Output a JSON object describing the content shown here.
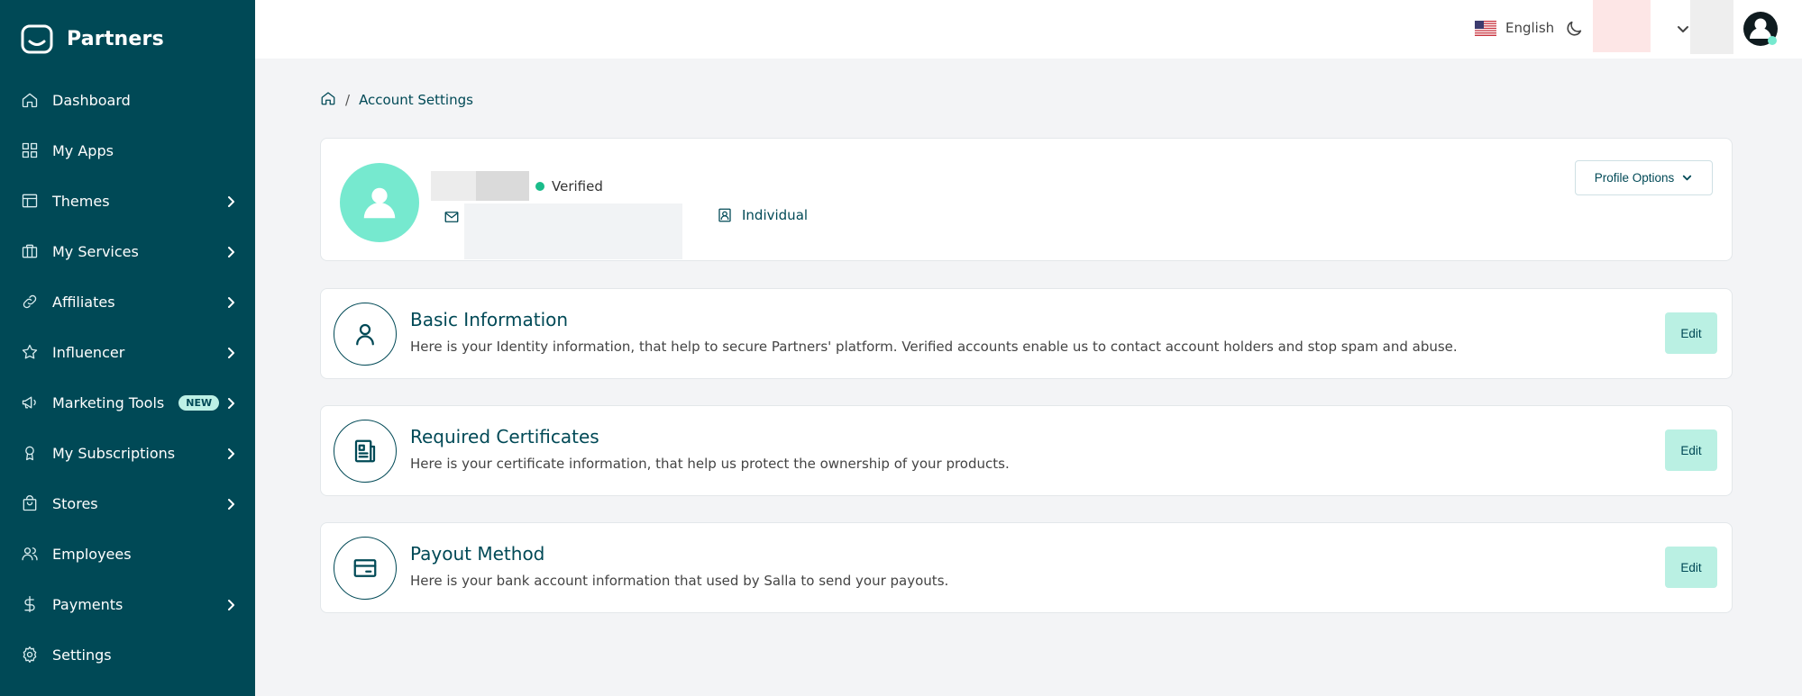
{
  "sidebar": {
    "brand": "Partners",
    "items": [
      {
        "label": "Dashboard",
        "icon": "home-icon",
        "has_chevron": false
      },
      {
        "label": "My Apps",
        "icon": "apps-grid-icon",
        "has_chevron": false
      },
      {
        "label": "Themes",
        "icon": "layout-icon",
        "has_chevron": true
      },
      {
        "label": "My Services",
        "icon": "briefcase-icon",
        "has_chevron": true
      },
      {
        "label": "Affiliates",
        "icon": "link-icon",
        "has_chevron": true
      },
      {
        "label": "Influencer",
        "icon": "star-icon",
        "has_chevron": true
      },
      {
        "label": "Marketing Tools",
        "icon": "megaphone-icon",
        "has_chevron": true,
        "badge": "NEW"
      },
      {
        "label": "My Subscriptions",
        "icon": "award-icon",
        "has_chevron": true
      },
      {
        "label": "Stores",
        "icon": "shopping-bag-icon",
        "has_chevron": true
      },
      {
        "label": "Employees",
        "icon": "users-icon",
        "has_chevron": false
      },
      {
        "label": "Payments",
        "icon": "dollar-icon",
        "has_chevron": true
      },
      {
        "label": "Settings",
        "icon": "gear-icon",
        "has_chevron": false
      }
    ]
  },
  "topbar": {
    "language": "English",
    "language_flag": "us-flag-icon",
    "theme_toggle": "moon-icon"
  },
  "breadcrumb": {
    "home_icon": "home-icon",
    "separator": "/",
    "current": "Account Settings"
  },
  "profile": {
    "status": "Verified",
    "account_type": "Individual",
    "options_label": "Profile Options"
  },
  "sections": [
    {
      "title": "Basic Information",
      "description": "Here is your Identity information, that help to secure Partners' platform. Verified accounts enable us to contact account holders and stop spam and abuse.",
      "icon": "user-icon",
      "action": "Edit"
    },
    {
      "title": "Required Certificates",
      "description": "Here is your certificate information, that help us protect the ownership of your products.",
      "icon": "certificate-icon",
      "action": "Edit"
    },
    {
      "title": "Payout Method",
      "description": "Here is your bank account information that used by Salla to send your payouts.",
      "icon": "wallet-icon",
      "action": "Edit"
    }
  ],
  "colors": {
    "sidebar_bg": "#004956",
    "accent": "#baf0e3",
    "avatar_bg": "#76e9cf",
    "verified_dot": "#1abc8a",
    "page_bg": "#f3f4f6"
  }
}
